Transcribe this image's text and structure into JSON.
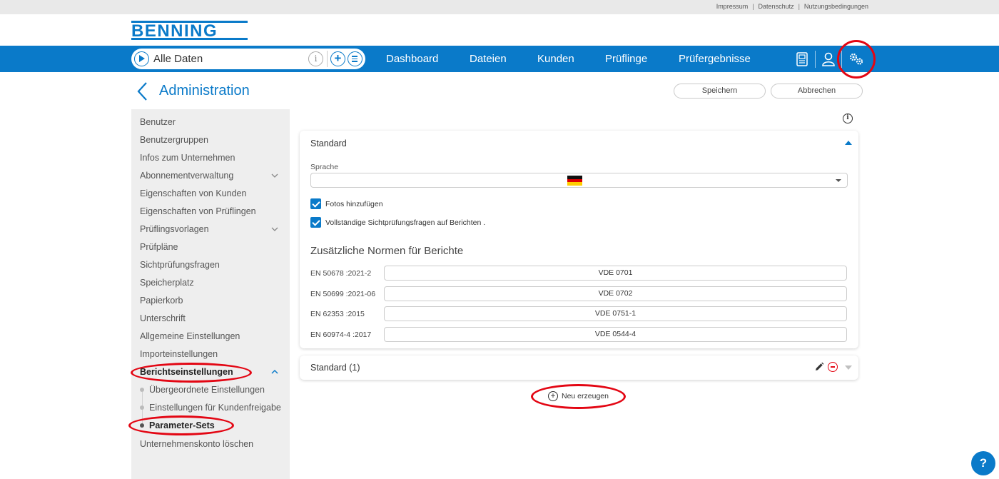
{
  "top_links": [
    "Impressum",
    "Datenschutz",
    "Nutzungsbedingungen"
  ],
  "brand": "BENNING",
  "search": {
    "label": "Alle Daten"
  },
  "nav": [
    "Dashboard",
    "Dateien",
    "Kunden",
    "Prüflinge",
    "Prüfergebnisse"
  ],
  "page": {
    "title": "Administration",
    "save": "Speichern",
    "cancel": "Abbrechen"
  },
  "sidebar": {
    "items": [
      "Benutzer",
      "Benutzergruppen",
      "Infos zum Unternehmen",
      "Abonnementverwaltung",
      "Eigenschaften von Kunden",
      "Eigenschaften von Prüflingen",
      "Prüflingsvorlagen",
      "Prüfpläne",
      "Sichtprüfungsfragen",
      "Speicherplatz",
      "Papierkorb",
      "Unterschrift",
      "Allgemeine Einstellungen",
      "Importeinstellungen",
      "Berichtseinstellungen"
    ],
    "subitems": [
      "Übergeordnete Einstellungen",
      "Einstellungen für Kundenfreigabe",
      "Parameter-Sets"
    ],
    "last": "Unternehmenskonto löschen"
  },
  "card": {
    "title": "Standard",
    "language_label": "Sprache",
    "checkbox1": "Fotos hinzufügen",
    "checkbox2": "Vollständige Sichtprüfungsfragen auf Berichten .",
    "norms_title": "Zusätzliche Normen für  Berichte",
    "norms": [
      {
        "label": "EN 50678 :2021-2",
        "value": "VDE 0701"
      },
      {
        "label": "EN 50699 :2021-06",
        "value": "VDE 0702"
      },
      {
        "label": "EN 62353 :2015",
        "value": "VDE 0751-1"
      },
      {
        "label": "EN 60974-4 :2017",
        "value": "VDE 0544-4"
      }
    ]
  },
  "card2": {
    "title": "Standard (1)"
  },
  "new_button": "Neu erzeugen",
  "help": "?",
  "colors": {
    "brand": "#0a7ac9",
    "highlight": "#e30613"
  }
}
